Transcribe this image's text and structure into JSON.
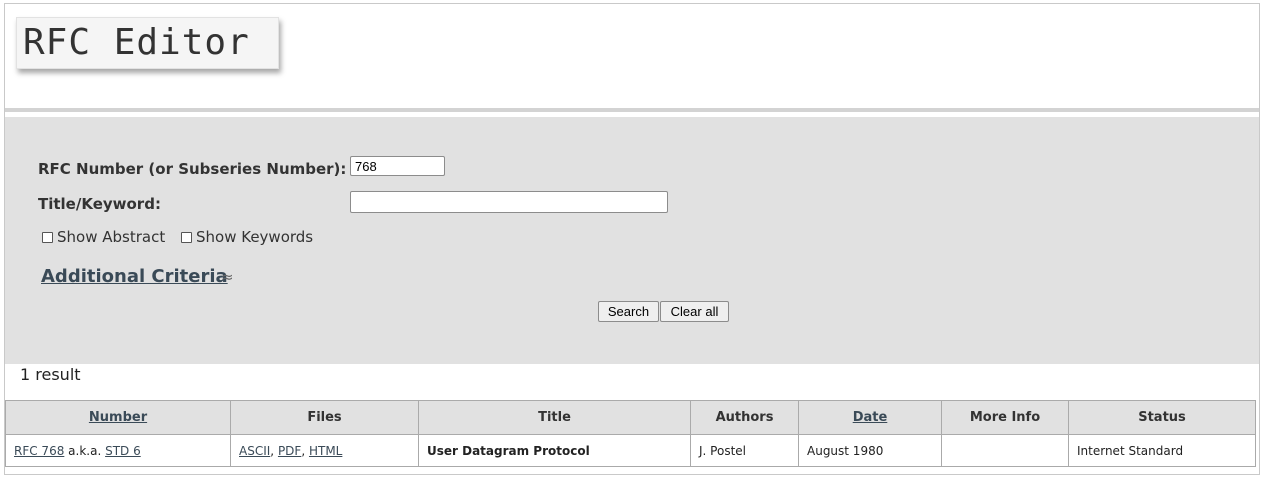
{
  "header": {
    "logo_text": "RFC Editor"
  },
  "search": {
    "rfc_number_label": "RFC Number (or Subseries Number):",
    "rfc_number_value": "768",
    "title_keyword_label": "Title/Keyword:",
    "title_keyword_value": "",
    "show_abstract_label": "Show Abstract",
    "show_keywords_label": "Show Keywords",
    "additional_criteria_label": "Additional Criteria ",
    "additional_criteria_icon": "≈",
    "search_button": "Search",
    "clear_button": "Clear all"
  },
  "results": {
    "count_text": "1 result",
    "columns": [
      "Number",
      "Files",
      "Title",
      "Authors",
      "Date",
      "More Info",
      "Status"
    ],
    "rows": [
      {
        "number_link": "RFC 768",
        "aka_text": " a.k.a. ",
        "std_link": "STD 6",
        "files": [
          "ASCII",
          "PDF",
          "HTML"
        ],
        "file_sep": ", ",
        "title": "User Datagram Protocol",
        "authors": "J. Postel",
        "date": "August 1980",
        "more_info": "",
        "status": "Internet Standard"
      }
    ]
  },
  "colors": {
    "link": "#3a4a57",
    "panel_bg": "#e1e1e1",
    "header_bg": "#e1e1e1"
  }
}
